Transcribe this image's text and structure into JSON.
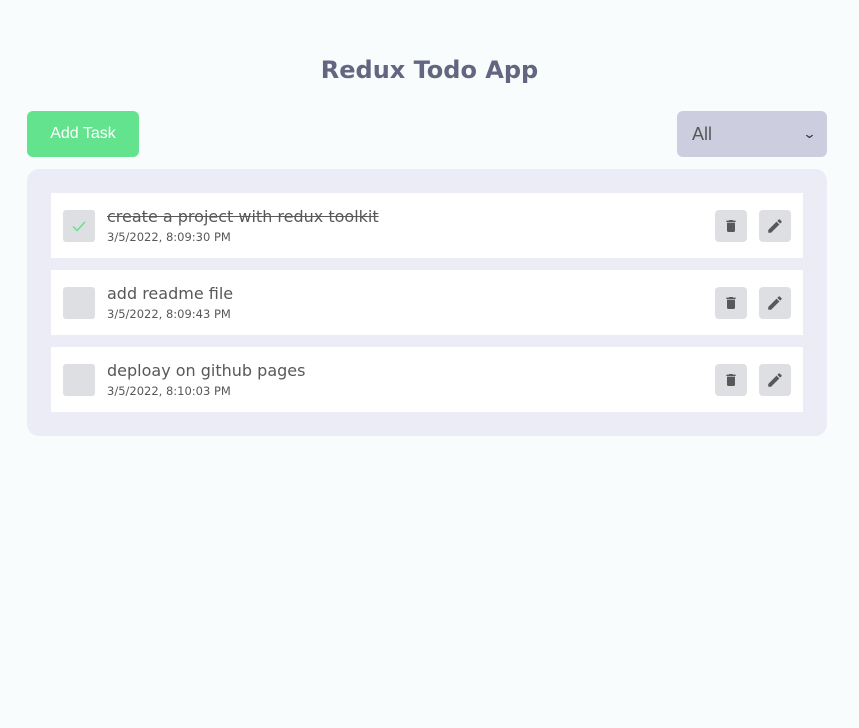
{
  "header": {
    "title": "Redux Todo App"
  },
  "toolbar": {
    "add_label": "Add Task",
    "filter_value": "All"
  },
  "colors": {
    "accent_green": "#64e38e",
    "title": "#646681",
    "select_bg": "#cccdde",
    "list_bg": "#ececf6"
  },
  "todos": [
    {
      "title": "create a project with redux toolkit",
      "time": "3/5/2022, 8:09:30 PM",
      "completed": true
    },
    {
      "title": "add readme file",
      "time": "3/5/2022, 8:09:43 PM",
      "completed": false
    },
    {
      "title": "deploay on github pages",
      "time": "3/5/2022, 8:10:03 PM",
      "completed": false
    }
  ],
  "icons": {
    "check": "check-icon",
    "delete": "trash-icon",
    "edit": "pencil-icon",
    "select_arrow": "chevron-down-icon"
  }
}
